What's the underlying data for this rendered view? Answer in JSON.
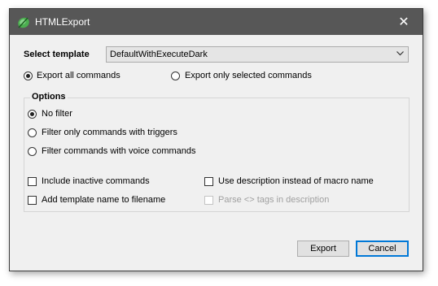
{
  "window": {
    "title": "HTMLExport",
    "close_glyph": "✕"
  },
  "template": {
    "label": "Select template",
    "value": "DefaultWithExecuteDark"
  },
  "export_scope": {
    "all_label": "Export all commands",
    "selected_label": "Export only selected commands",
    "selected": "all"
  },
  "options": {
    "title": "Options",
    "filters": [
      {
        "label": "No filter",
        "checked": true
      },
      {
        "label": "Filter only commands with triggers",
        "checked": false
      },
      {
        "label": "Filter commands with voice commands",
        "checked": false
      }
    ],
    "checkboxes": {
      "include_inactive": "Include inactive commands",
      "add_template_name": "Add template name to filename",
      "use_description": "Use description instead of macro name",
      "parse_tags": "Parse <> tags in description"
    }
  },
  "buttons": {
    "export": "Export",
    "cancel": "Cancel"
  },
  "colors": {
    "titlebar": "#575757",
    "accent": "#0078d7",
    "dialog_bg": "#f0f0f0"
  },
  "icons": {
    "app": "app-leaf-icon",
    "close": "close-icon",
    "dropdown": "chevron-down-icon"
  }
}
